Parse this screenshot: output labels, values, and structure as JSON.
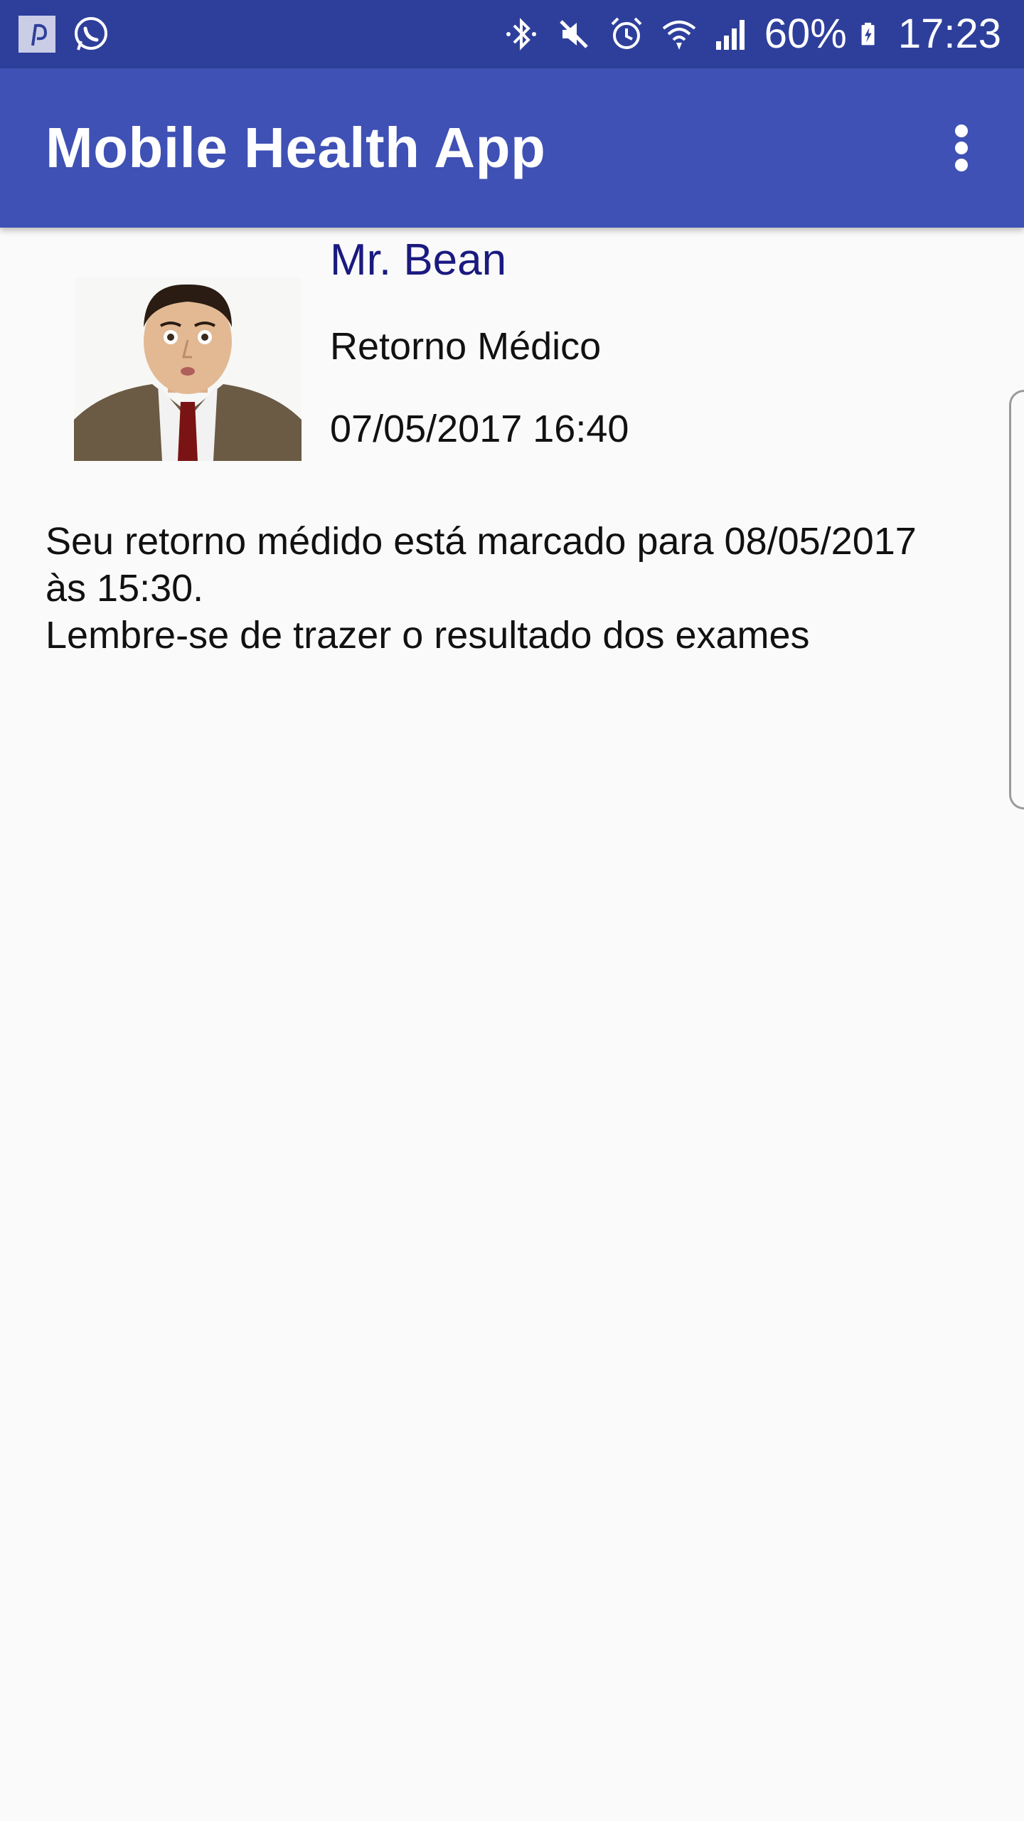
{
  "status_bar": {
    "battery": "60%",
    "time": "17:23",
    "notification_icons": [
      "pinterest-icon",
      "whatsapp-icon"
    ],
    "system_icons": [
      "bluetooth-icon",
      "mute-icon",
      "alarm-icon",
      "wifi-icon",
      "signal-icon",
      "battery-charging-icon"
    ]
  },
  "app_bar": {
    "title": "Mobile Health App",
    "menu_icon": "more-vert-icon"
  },
  "appointment": {
    "name": "Mr. Bean",
    "type": "Retorno Médico",
    "datetime": "07/05/2017 16:40",
    "message_lines": [
      "Seu retorno médido está marcado para 08/05/2017",
      "às 15:30.",
      "Lembre-se de trazer o resultado dos exames"
    ]
  },
  "colors": {
    "status_bar": "#2e3f9b",
    "app_bar": "#3f51b5",
    "name_text": "#1a1a80",
    "background": "#fafafa"
  }
}
